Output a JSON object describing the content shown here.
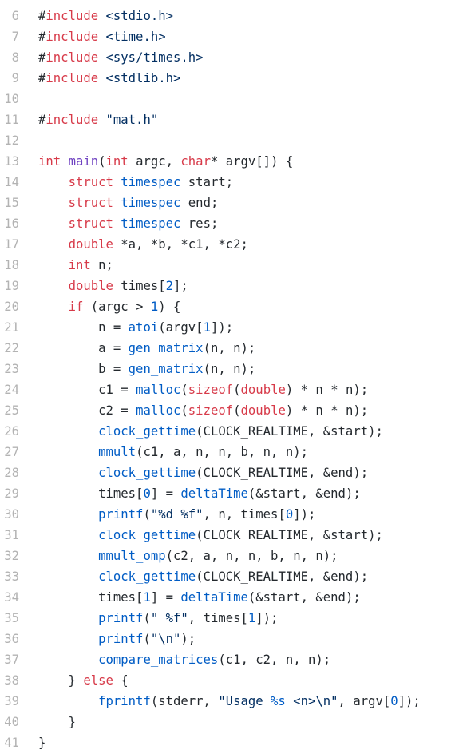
{
  "file": {
    "language": "c",
    "colors": {
      "keyword": "#d73a49",
      "function": "#005cc5",
      "entity": "#6f42c1",
      "string": "#032f62",
      "number": "#005cc5",
      "text": "#24292e",
      "line_number": "#b3b3b3",
      "background": "#ffffff"
    },
    "lines": [
      {
        "n": "6",
        "tokens": [
          [
            "txt",
            "#"
          ],
          [
            "kw",
            "include"
          ],
          [
            "txt",
            " "
          ],
          [
            "str",
            "<stdio.h>"
          ]
        ]
      },
      {
        "n": "7",
        "tokens": [
          [
            "txt",
            "#"
          ],
          [
            "kw",
            "include"
          ],
          [
            "txt",
            " "
          ],
          [
            "str",
            "<time.h>"
          ]
        ]
      },
      {
        "n": "8",
        "tokens": [
          [
            "txt",
            "#"
          ],
          [
            "kw",
            "include"
          ],
          [
            "txt",
            " "
          ],
          [
            "str",
            "<sys/times.h>"
          ]
        ]
      },
      {
        "n": "9",
        "tokens": [
          [
            "txt",
            "#"
          ],
          [
            "kw",
            "include"
          ],
          [
            "txt",
            " "
          ],
          [
            "str",
            "<stdlib.h>"
          ]
        ]
      },
      {
        "n": "10",
        "tokens": []
      },
      {
        "n": "11",
        "tokens": [
          [
            "txt",
            "#"
          ],
          [
            "kw",
            "include"
          ],
          [
            "txt",
            " "
          ],
          [
            "str",
            "\"mat.h\""
          ]
        ]
      },
      {
        "n": "12",
        "tokens": []
      },
      {
        "n": "13",
        "tokens": [
          [
            "kw",
            "int"
          ],
          [
            "txt",
            " "
          ],
          [
            "ent",
            "main"
          ],
          [
            "txt",
            "("
          ],
          [
            "kw",
            "int"
          ],
          [
            "txt",
            " argc, "
          ],
          [
            "kw",
            "char"
          ],
          [
            "txt",
            "* argv[]) {"
          ]
        ]
      },
      {
        "n": "14",
        "tokens": [
          [
            "txt",
            "    "
          ],
          [
            "kw",
            "struct"
          ],
          [
            "txt",
            " "
          ],
          [
            "fn",
            "timespec"
          ],
          [
            "txt",
            " start;"
          ]
        ]
      },
      {
        "n": "15",
        "tokens": [
          [
            "txt",
            "    "
          ],
          [
            "kw",
            "struct"
          ],
          [
            "txt",
            " "
          ],
          [
            "fn",
            "timespec"
          ],
          [
            "txt",
            " end;"
          ]
        ]
      },
      {
        "n": "16",
        "tokens": [
          [
            "txt",
            "    "
          ],
          [
            "kw",
            "struct"
          ],
          [
            "txt",
            " "
          ],
          [
            "fn",
            "timespec"
          ],
          [
            "txt",
            " res;"
          ]
        ]
      },
      {
        "n": "17",
        "tokens": [
          [
            "txt",
            "    "
          ],
          [
            "kw",
            "double"
          ],
          [
            "txt",
            " *a, *b, *c1, *c2;"
          ]
        ]
      },
      {
        "n": "18",
        "tokens": [
          [
            "txt",
            "    "
          ],
          [
            "kw",
            "int"
          ],
          [
            "txt",
            " n;"
          ]
        ]
      },
      {
        "n": "19",
        "tokens": [
          [
            "txt",
            "    "
          ],
          [
            "kw",
            "double"
          ],
          [
            "txt",
            " times["
          ],
          [
            "num",
            "2"
          ],
          [
            "txt",
            "];"
          ]
        ]
      },
      {
        "n": "20",
        "tokens": [
          [
            "txt",
            "    "
          ],
          [
            "kw",
            "if"
          ],
          [
            "txt",
            " (argc > "
          ],
          [
            "num",
            "1"
          ],
          [
            "txt",
            ") {"
          ]
        ]
      },
      {
        "n": "21",
        "tokens": [
          [
            "txt",
            "        n = "
          ],
          [
            "fn",
            "atoi"
          ],
          [
            "txt",
            "(argv["
          ],
          [
            "num",
            "1"
          ],
          [
            "txt",
            "]);"
          ]
        ]
      },
      {
        "n": "22",
        "tokens": [
          [
            "txt",
            "        a = "
          ],
          [
            "fn",
            "gen_matrix"
          ],
          [
            "txt",
            "(n, n);"
          ]
        ]
      },
      {
        "n": "23",
        "tokens": [
          [
            "txt",
            "        b = "
          ],
          [
            "fn",
            "gen_matrix"
          ],
          [
            "txt",
            "(n, n);"
          ]
        ]
      },
      {
        "n": "24",
        "tokens": [
          [
            "txt",
            "        c1 = "
          ],
          [
            "fn",
            "malloc"
          ],
          [
            "txt",
            "("
          ],
          [
            "kw",
            "sizeof"
          ],
          [
            "txt",
            "("
          ],
          [
            "kw",
            "double"
          ],
          [
            "txt",
            ") * n * n);"
          ]
        ]
      },
      {
        "n": "25",
        "tokens": [
          [
            "txt",
            "        c2 = "
          ],
          [
            "fn",
            "malloc"
          ],
          [
            "txt",
            "("
          ],
          [
            "kw",
            "sizeof"
          ],
          [
            "txt",
            "("
          ],
          [
            "kw",
            "double"
          ],
          [
            "txt",
            ") * n * n);"
          ]
        ]
      },
      {
        "n": "26",
        "tokens": [
          [
            "txt",
            "        "
          ],
          [
            "fn",
            "clock_gettime"
          ],
          [
            "txt",
            "(CLOCK_REALTIME, &start);"
          ]
        ]
      },
      {
        "n": "27",
        "tokens": [
          [
            "txt",
            "        "
          ],
          [
            "fn",
            "mmult"
          ],
          [
            "txt",
            "(c1, a, n, n, b, n, n);"
          ]
        ]
      },
      {
        "n": "28",
        "tokens": [
          [
            "txt",
            "        "
          ],
          [
            "fn",
            "clock_gettime"
          ],
          [
            "txt",
            "(CLOCK_REALTIME, &end);"
          ]
        ]
      },
      {
        "n": "29",
        "tokens": [
          [
            "txt",
            "        times["
          ],
          [
            "num",
            "0"
          ],
          [
            "txt",
            "] = "
          ],
          [
            "fn",
            "deltaTime"
          ],
          [
            "txt",
            "(&start, &end);"
          ]
        ]
      },
      {
        "n": "30",
        "tokens": [
          [
            "txt",
            "        "
          ],
          [
            "fn",
            "printf"
          ],
          [
            "txt",
            "("
          ],
          [
            "str",
            "\"%d %f\""
          ],
          [
            "txt",
            ", n, times["
          ],
          [
            "num",
            "0"
          ],
          [
            "txt",
            "]);"
          ]
        ]
      },
      {
        "n": "31",
        "tokens": [
          [
            "txt",
            "        "
          ],
          [
            "fn",
            "clock_gettime"
          ],
          [
            "txt",
            "(CLOCK_REALTIME, &start);"
          ]
        ]
      },
      {
        "n": "32",
        "tokens": [
          [
            "txt",
            "        "
          ],
          [
            "fn",
            "mmult_omp"
          ],
          [
            "txt",
            "(c2, a, n, n, b, n, n);"
          ]
        ]
      },
      {
        "n": "33",
        "tokens": [
          [
            "txt",
            "        "
          ],
          [
            "fn",
            "clock_gettime"
          ],
          [
            "txt",
            "(CLOCK_REALTIME, &end);"
          ]
        ]
      },
      {
        "n": "34",
        "tokens": [
          [
            "txt",
            "        times["
          ],
          [
            "num",
            "1"
          ],
          [
            "txt",
            "] = "
          ],
          [
            "fn",
            "deltaTime"
          ],
          [
            "txt",
            "(&start, &end);"
          ]
        ]
      },
      {
        "n": "35",
        "tokens": [
          [
            "txt",
            "        "
          ],
          [
            "fn",
            "printf"
          ],
          [
            "txt",
            "("
          ],
          [
            "str",
            "\" %f\""
          ],
          [
            "txt",
            ", times["
          ],
          [
            "num",
            "1"
          ],
          [
            "txt",
            "]);"
          ]
        ]
      },
      {
        "n": "36",
        "tokens": [
          [
            "txt",
            "        "
          ],
          [
            "fn",
            "printf"
          ],
          [
            "txt",
            "("
          ],
          [
            "str",
            "\"\\n\""
          ],
          [
            "txt",
            ");"
          ]
        ]
      },
      {
        "n": "37",
        "tokens": [
          [
            "txt",
            "        "
          ],
          [
            "fn",
            "compare_matrices"
          ],
          [
            "txt",
            "(c1, c2, n, n);"
          ]
        ]
      },
      {
        "n": "38",
        "tokens": [
          [
            "txt",
            "    } "
          ],
          [
            "kw",
            "else"
          ],
          [
            "txt",
            " {"
          ]
        ]
      },
      {
        "n": "39",
        "tokens": [
          [
            "txt",
            "        "
          ],
          [
            "fn",
            "fprintf"
          ],
          [
            "txt",
            "(stderr, "
          ],
          [
            "str",
            "\"Usage "
          ],
          [
            "fmt",
            "%s"
          ],
          [
            "str",
            " <n>\\n\""
          ],
          [
            "txt",
            ", argv["
          ],
          [
            "num",
            "0"
          ],
          [
            "txt",
            "]);"
          ]
        ]
      },
      {
        "n": "40",
        "tokens": [
          [
            "txt",
            "    }"
          ]
        ]
      },
      {
        "n": "41",
        "tokens": [
          [
            "txt",
            "}"
          ]
        ]
      }
    ]
  }
}
